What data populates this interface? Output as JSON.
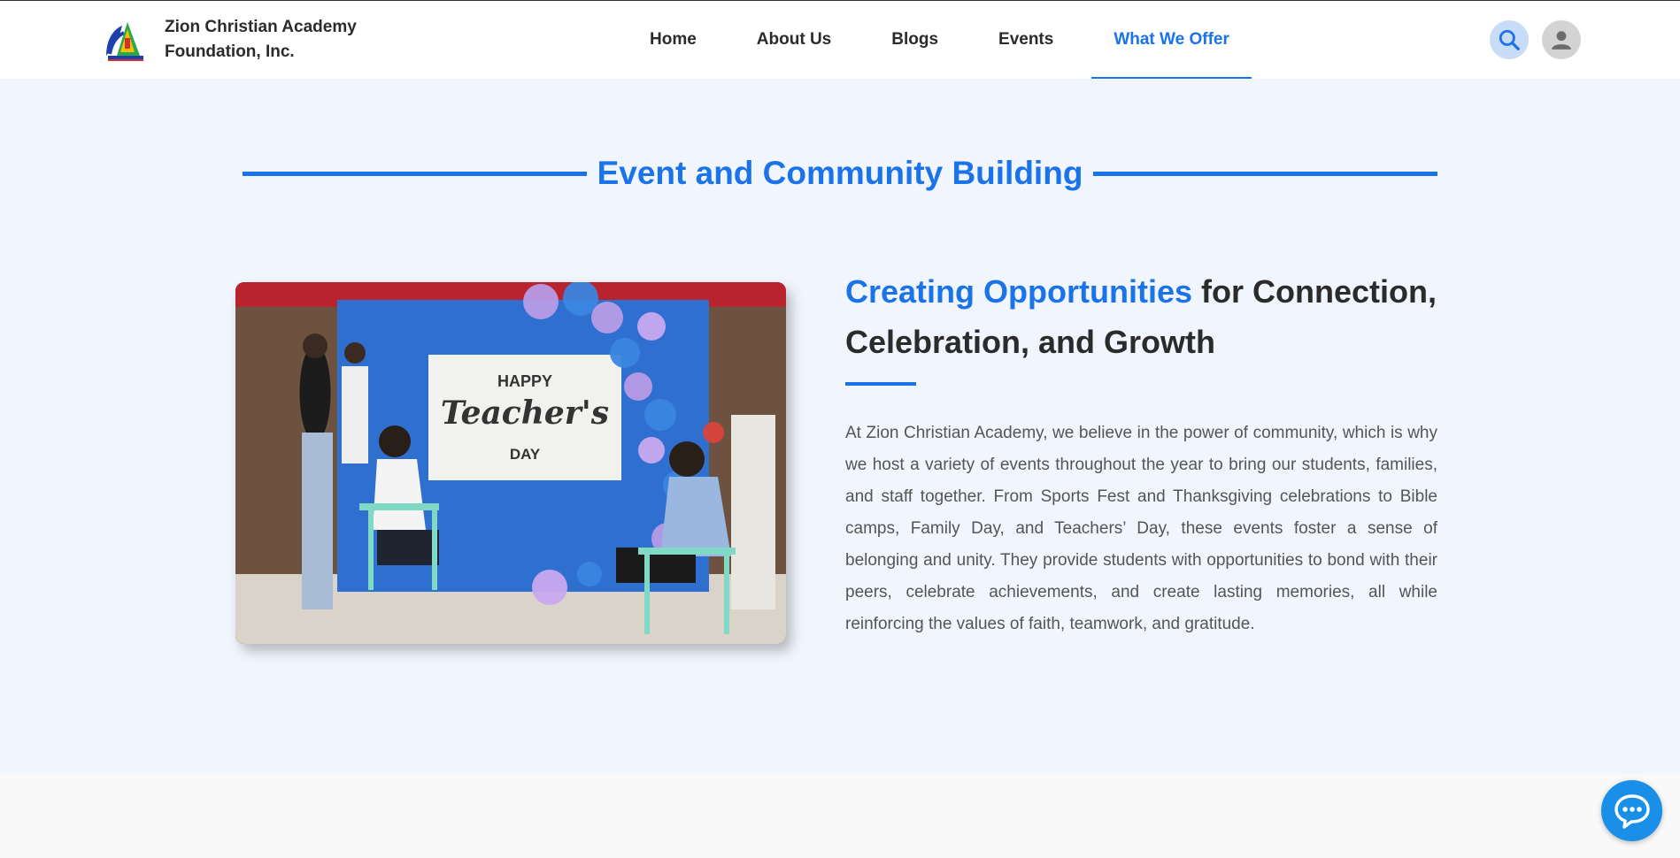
{
  "header": {
    "org_name": "Zion Christian Academy Foundation, Inc.",
    "nav": [
      {
        "label": "Home"
      },
      {
        "label": "About Us"
      },
      {
        "label": "Blogs"
      },
      {
        "label": "Events"
      },
      {
        "label": "What We Offer",
        "active": true
      }
    ],
    "icons": {
      "search": "search-icon",
      "profile": "user-icon",
      "logo": "school-logo"
    }
  },
  "section": {
    "title": "Event and Community Building",
    "headline_accent": "Creating Opportunities",
    "headline_rest": " for Connection, Celebration, and Growth",
    "body": "At Zion Christian Academy, we believe in the power of community, which is why we host a variety of events throughout the year to bring our students, families, and staff together. From Sports Fest and Thanksgiving celebrations to Bible camps, Family Day, and Teachers’ Day, these events foster a sense of belonging and unity. They provide students with opportunities to bond with their peers, celebrate achievements, and create lasting memories, all while reinforcing the values of faith, teamwork, and gratitude.",
    "photo_banner": {
      "line1": "HAPPY",
      "line2": "Teacher's",
      "line3": "DAY"
    }
  },
  "chat": {
    "icon": "chat-bubble-icon"
  },
  "colors": {
    "accent": "#1a73e8",
    "background": "#f1f5fd",
    "text": "#2b2b2b"
  }
}
